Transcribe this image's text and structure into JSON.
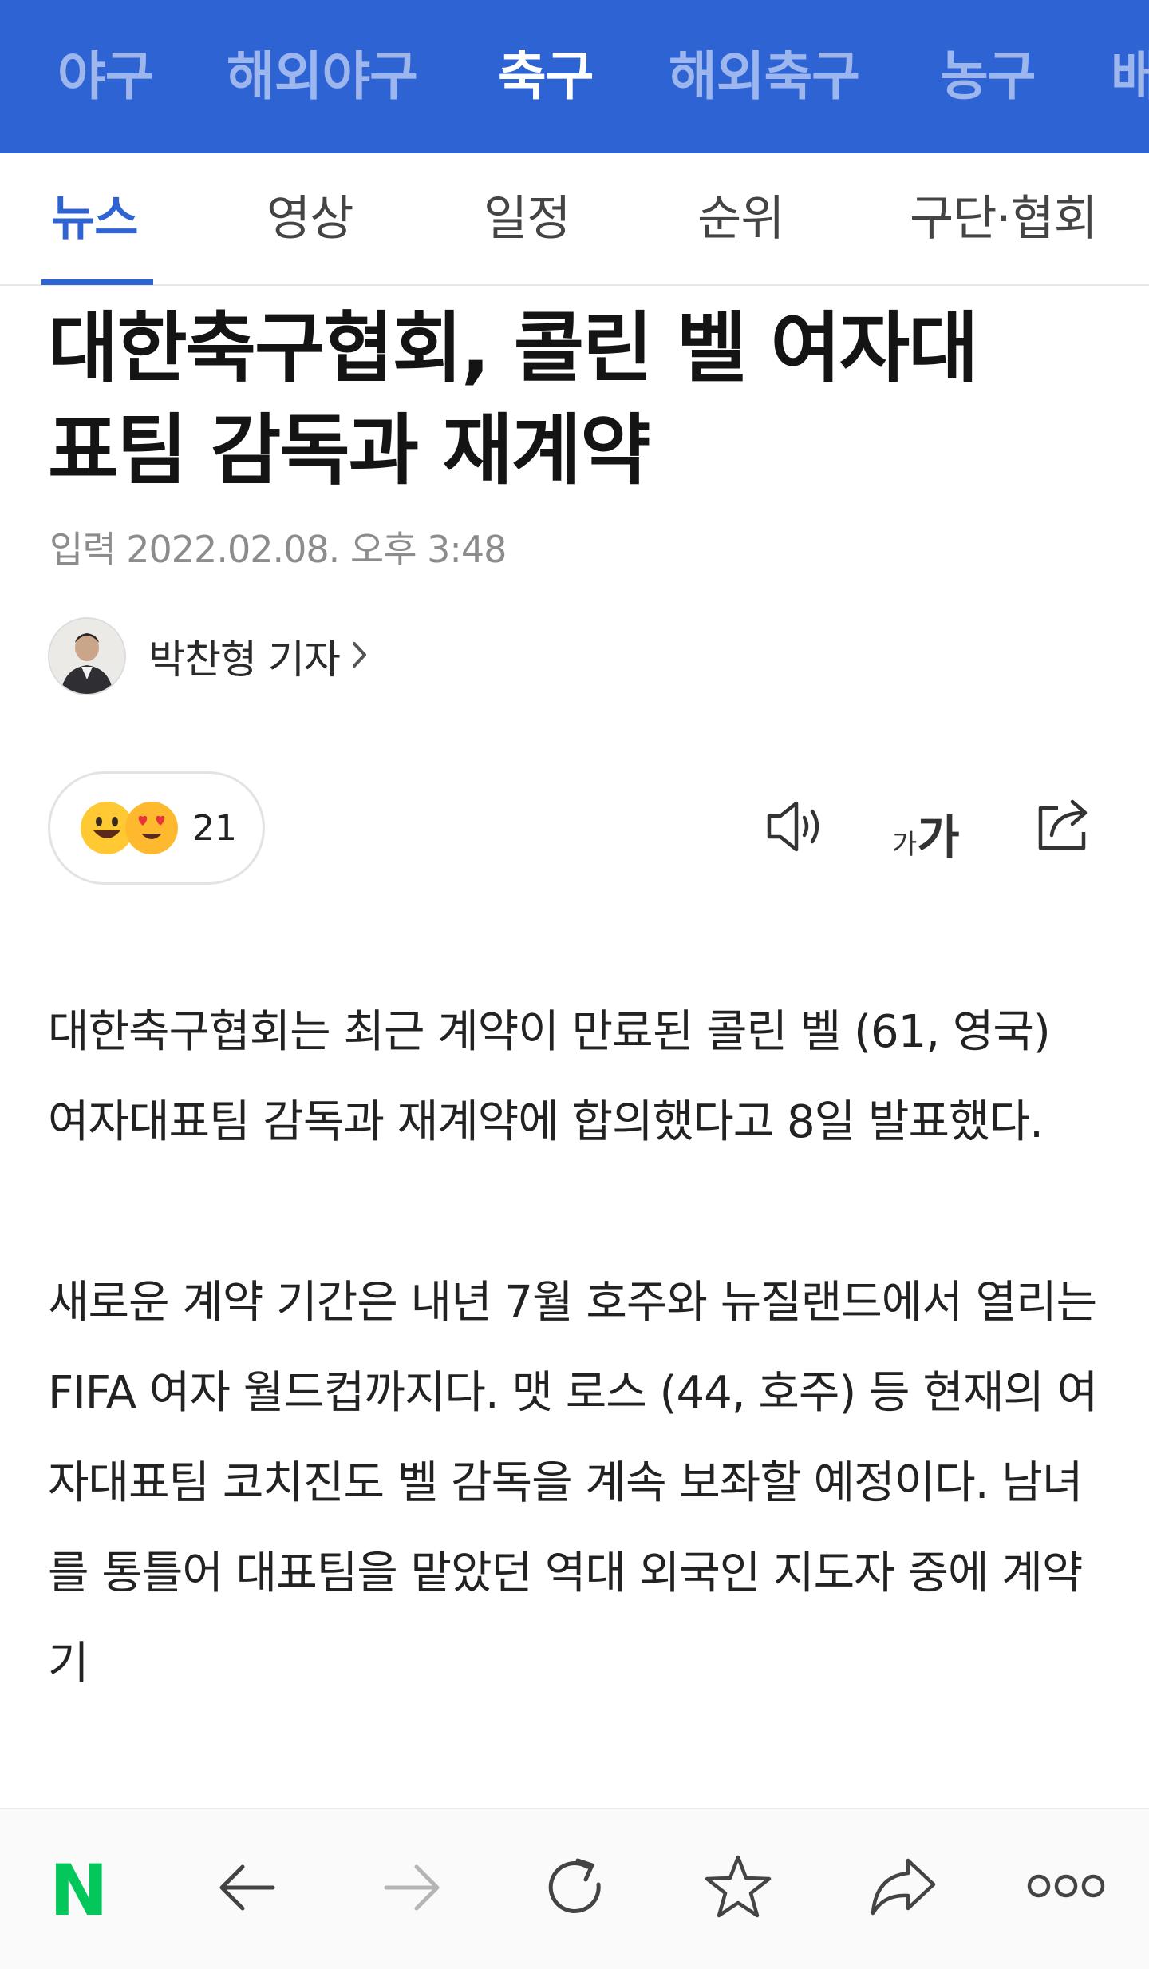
{
  "sport_nav": {
    "items": [
      {
        "label": "야구",
        "active": false
      },
      {
        "label": "해외야구",
        "active": false
      },
      {
        "label": "축구",
        "active": true
      },
      {
        "label": "해외축구",
        "active": false
      },
      {
        "label": "농구",
        "active": false
      },
      {
        "label": "배",
        "active": false
      }
    ]
  },
  "sub_tabs": {
    "items": [
      {
        "label": "뉴스",
        "active": true
      },
      {
        "label": "영상",
        "active": false
      },
      {
        "label": "일정",
        "active": false
      },
      {
        "label": "순위",
        "active": false
      },
      {
        "label": "구단·협회",
        "active": false
      }
    ]
  },
  "article": {
    "headline_line1": "대한축구협회, 콜린 벨 여자대",
    "headline_line2": "표팀 감독과 재계약",
    "date": "입력 2022.02.08. 오후 3:48",
    "reporter": "박찬형 기자",
    "reaction_count": "21",
    "font_size_icon_label_small": "가",
    "font_size_icon_label_large": "가",
    "paragraphs": [
      "대한축구협회는 최근 계약이 만료된 콜린 벨 (61, 영국) 여자대표팀 감독과 재계약에 합의했다고 8일 발표했다.",
      "새로운 계약 기간은 내년 7월 호주와 뉴질랜드에서 열리는 FIFA 여자 월드컵까지다. 맷 로스 (44, 호주) 등 현재의 여자대표팀 코치진도 벨 감독을 계속 보좌할 예정이다. 남녀를 통틀어 대표팀을 맡았던 역대 외국인 지도자 중에 계약기"
    ]
  },
  "bottom_bar": {
    "logo_letter": "N",
    "brand_color": "#03c75a"
  },
  "colors": {
    "nav_bg": "#2e63d3",
    "accent": "#2e63d3"
  }
}
